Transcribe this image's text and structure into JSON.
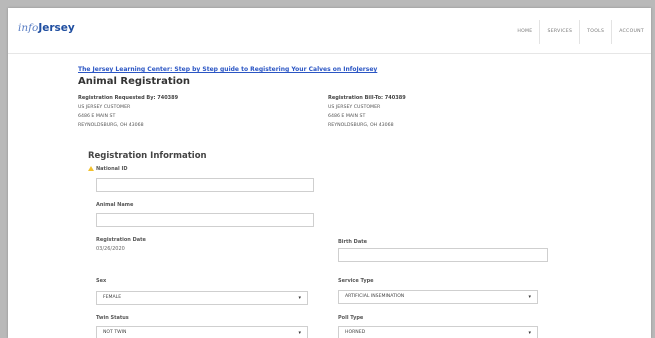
{
  "app": {
    "logo_prefix": "info",
    "logo_name": "Jersey"
  },
  "nav": {
    "items": [
      "HOME",
      "SERVICES",
      "TOOLS",
      "ACCOUNT"
    ]
  },
  "guide_link": "The Jersey Learning Center: Step by Step guide to Registering Your Calves on InfoJersey",
  "page_title": "Animal Registration",
  "requested_by": {
    "heading": "Registration Requested By: 740389",
    "name": "US JERSEY CUSTOMER",
    "street": "6486 E MAIN ST",
    "city": "REYNOLDSBURG, OH  43068"
  },
  "bill_to": {
    "heading": "Registration Bill-To: 740389",
    "name": "US JERSEY CUSTOMER",
    "street": "6486 E MAIN ST",
    "city": "REYNOLDSBURG, OH  43068"
  },
  "section_title": "Registration Information",
  "fields": {
    "national_id": {
      "label": "National ID",
      "value": ""
    },
    "animal_name": {
      "label": "Animal Name",
      "value": ""
    },
    "registration_date": {
      "label": "Registration Date",
      "value": "03/26/2020"
    },
    "birth_date": {
      "label": "Birth Date",
      "value": ""
    },
    "sex": {
      "label": "Sex",
      "value": "FEMALE"
    },
    "service_type": {
      "label": "Service Type",
      "value": "ARTIFICIAL INSEMINATION"
    },
    "twin_status": {
      "label": "Twin Status",
      "value": "NOT TWIN"
    },
    "poll_type": {
      "label": "Poll Type",
      "value": "HORNED"
    }
  },
  "icons": {
    "caret": "▾",
    "required_marker": "warning-icon"
  },
  "colors": {
    "link": "#2a55c4",
    "logo_blue": "#1f4ea0",
    "warning": "#f2c12e"
  }
}
